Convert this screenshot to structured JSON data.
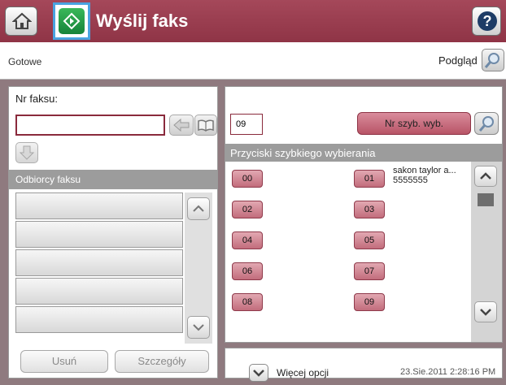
{
  "header": {
    "title": "Wyślij faks"
  },
  "status": {
    "text": "Gotowe",
    "preview_label": "Podgląd"
  },
  "left": {
    "fax_label": "Nr faksu:",
    "fax_value": "",
    "recipients_header": "Odbiorcy faksu",
    "delete_label": "Usuń",
    "details_label": "Szczegóły"
  },
  "right": {
    "speed_value": "09",
    "speed_button": "Nr szyb. wyb.",
    "speed_header": "Przyciski szybkiego wybierania",
    "speed_dials": [
      "00",
      "01",
      "02",
      "03",
      "04",
      "05",
      "06",
      "07",
      "08",
      "09"
    ],
    "entry_01_name": "sakon taylor a...",
    "entry_01_number": "5555555"
  },
  "footer": {
    "more_options": "Więcej opcji",
    "datetime": "23.Sie.2011 2:28:16 PM"
  }
}
